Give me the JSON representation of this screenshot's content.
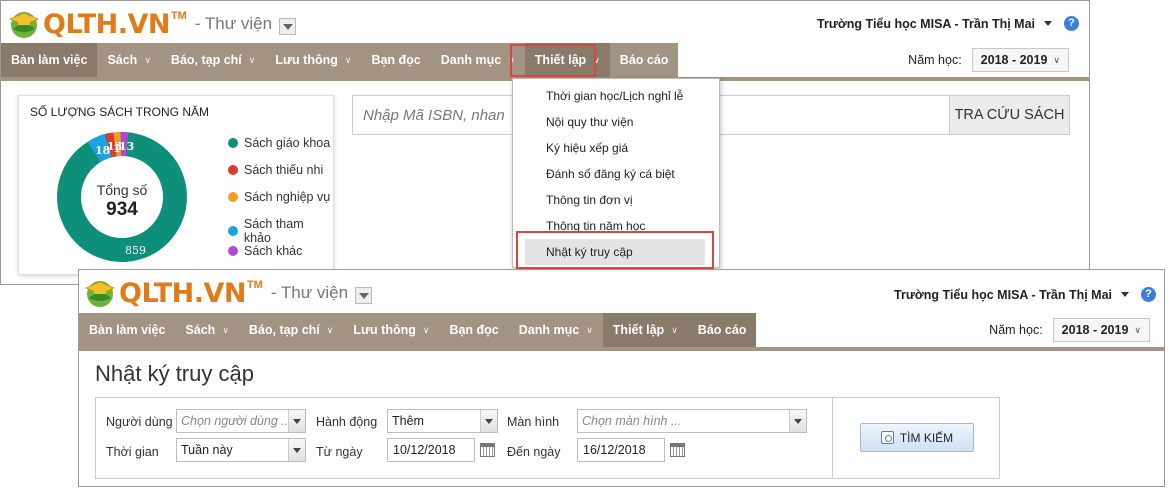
{
  "app": {
    "logo_text": "QLTH.VN",
    "logo_tm": "TM",
    "module": "- Thư viện",
    "user": "Trường Tiểu học MISA - Trần Thị Mai",
    "help": "?"
  },
  "nav": {
    "items": [
      "Bàn làm việc",
      "Sách",
      "Báo, tạp chí",
      "Lưu thông",
      "Bạn đọc",
      "Danh mục",
      "Thiết lập",
      "Báo cáo"
    ],
    "year_label": "Năm học:",
    "year_value": "2018 - 2019"
  },
  "dashboard": {
    "stats_title": "SỐ LƯỢNG SÁCH TRONG NĂM",
    "total_label": "Tổng số",
    "total_value": "934",
    "slice_labels": {
      "main": "859",
      "small": "1",
      "a": "18",
      "b": "13",
      "c": "13"
    },
    "legend": [
      {
        "label": "Sách giáo khoa",
        "color": "#0d8f7a"
      },
      {
        "label": "Sách thiếu nhi",
        "color": "#e0392d"
      },
      {
        "label": "Sách nghiệp vụ",
        "color": "#f0a020"
      },
      {
        "label": "Sách tham khảo",
        "color": "#1aa3e0"
      },
      {
        "label": "Sách khác",
        "color": "#b347d4"
      }
    ],
    "isbn_placeholder": "Nhập Mã ISBN, nhan",
    "isbn_button": "TRA CỨU SÁCH"
  },
  "settings_menu": {
    "items": [
      "Thời gian học/Lịch nghỉ lễ",
      "Nội quy thư viện",
      "Ký hiệu xếp giá",
      "Đánh số đăng ký cá biệt",
      "Thông tin đơn vị",
      "Thông tin năm học",
      "Nhật ký truy cập"
    ]
  },
  "access_log": {
    "title": "Nhật ký truy cập",
    "labels": {
      "user": "Người dùng",
      "action": "Hành động",
      "screen": "Màn hình",
      "time": "Thời gian",
      "from": "Từ ngày",
      "to": "Đến ngày"
    },
    "user_placeholder": "Chọn người dùng ...",
    "action_value": "Thêm",
    "screen_placeholder": "Chọn màn hình ...",
    "time_value": "Tuần này",
    "from_date": "10/12/2018",
    "to_date": "16/12/2018",
    "search_button": "TÌM KIẾM"
  }
}
